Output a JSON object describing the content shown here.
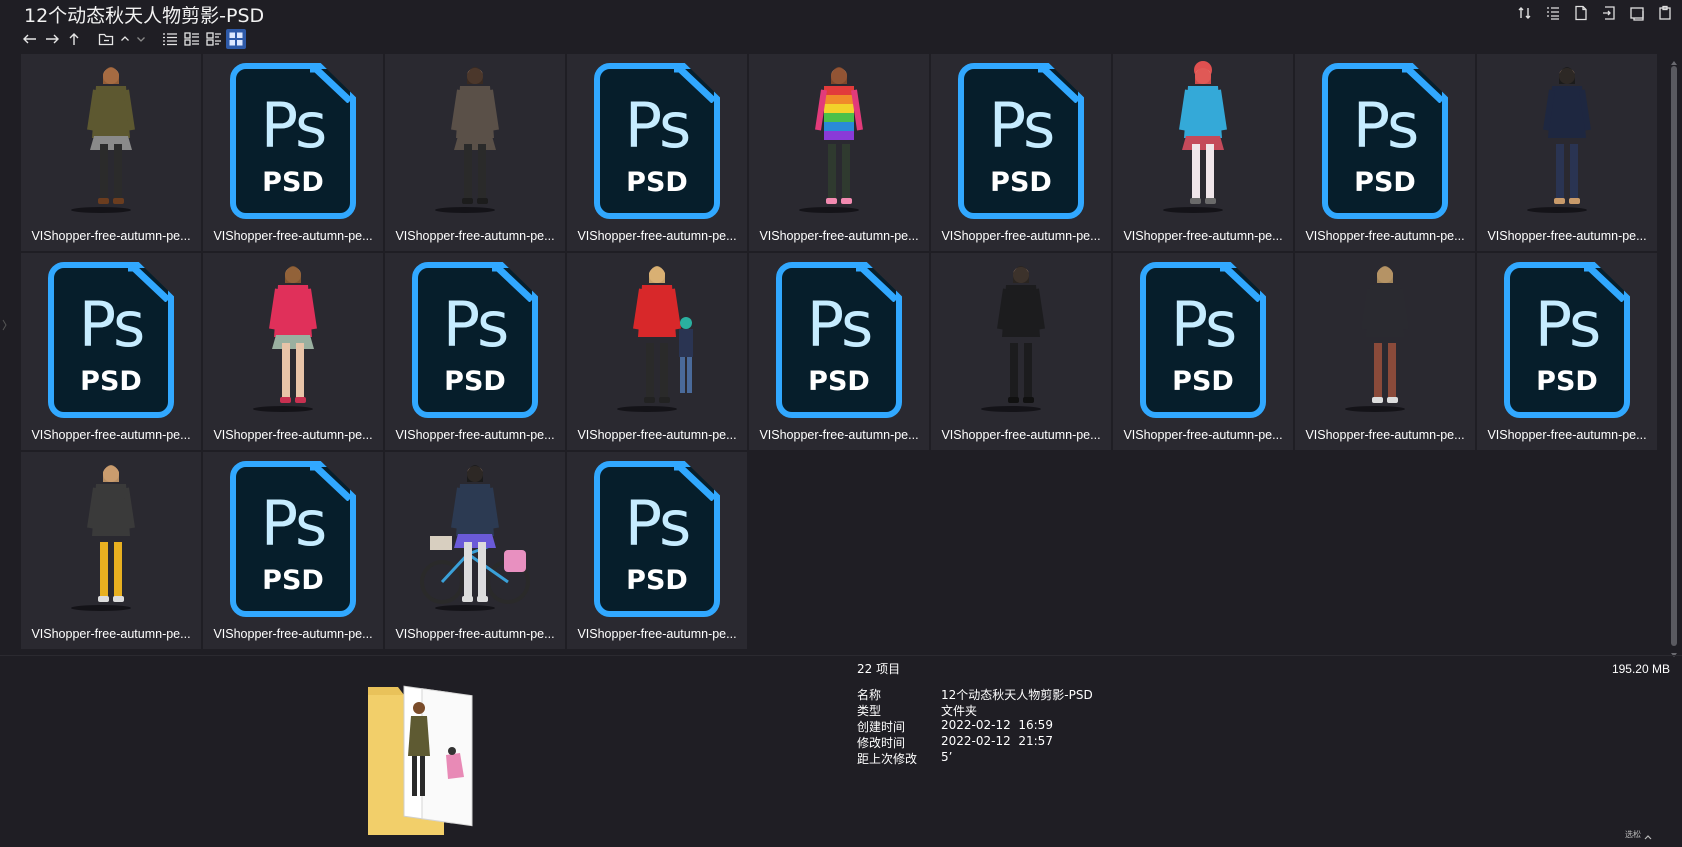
{
  "window": {
    "title": "12个动态秋天人物剪影-PSD",
    "actions": [
      {
        "icon": "sort-icon"
      },
      {
        "icon": "list-detail-icon"
      },
      {
        "icon": "new-file-icon"
      },
      {
        "icon": "file-export-icon"
      },
      {
        "icon": "panel-icon"
      },
      {
        "icon": "clipboard-icon"
      }
    ]
  },
  "toolbar": {
    "nav": [
      "back-arrow-icon",
      "forward-arrow-icon",
      "up-arrow-icon",
      "folder-icon",
      "chevron-up-icon",
      "chevron-down-icon"
    ],
    "views": [
      "list-view-icon",
      "details-view-icon",
      "tiles-view-icon",
      "large-icons-view-icon"
    ],
    "active_view": "large-icons-view-icon"
  },
  "accent_color": "#31a8ff",
  "files": [
    {
      "name": "VIShopper-free-autumn-pe...",
      "kind": "image",
      "figure": "woman-brown-jacket"
    },
    {
      "name": "VIShopper-free-autumn-pe...",
      "kind": "psd"
    },
    {
      "name": "VIShopper-free-autumn-pe...",
      "kind": "image",
      "figure": "woman-grey-coat"
    },
    {
      "name": "VIShopper-free-autumn-pe...",
      "kind": "psd"
    },
    {
      "name": "VIShopper-free-autumn-pe...",
      "kind": "image",
      "figure": "woman-rainbow-jacket"
    },
    {
      "name": "VIShopper-free-autumn-pe...",
      "kind": "psd"
    },
    {
      "name": "VIShopper-free-autumn-pe...",
      "kind": "image",
      "figure": "girl-running-blue"
    },
    {
      "name": "VIShopper-free-autumn-pe...",
      "kind": "psd"
    },
    {
      "name": "VIShopper-free-autumn-pe...",
      "kind": "image",
      "figure": "woman-navy-coat"
    },
    {
      "name": "VIShopper-free-autumn-pe...",
      "kind": "psd"
    },
    {
      "name": "VIShopper-free-autumn-pe...",
      "kind": "image",
      "figure": "woman-pink-jacket"
    },
    {
      "name": "VIShopper-free-autumn-pe...",
      "kind": "psd"
    },
    {
      "name": "VIShopper-free-autumn-pe...",
      "kind": "image",
      "figure": "woman-red-coat-child"
    },
    {
      "name": "VIShopper-free-autumn-pe...",
      "kind": "psd"
    },
    {
      "name": "VIShopper-free-autumn-pe...",
      "kind": "image",
      "figure": "man-dark-suit"
    },
    {
      "name": "VIShopper-free-autumn-pe...",
      "kind": "psd"
    },
    {
      "name": "VIShopper-free-autumn-pe...",
      "kind": "image",
      "figure": "man-grey-coat-phone"
    },
    {
      "name": "VIShopper-free-autumn-pe...",
      "kind": "psd"
    },
    {
      "name": "VIShopper-free-autumn-pe...",
      "kind": "image",
      "figure": "man-yellow-pants"
    },
    {
      "name": "VIShopper-free-autumn-pe...",
      "kind": "psd"
    },
    {
      "name": "VIShopper-free-autumn-pe...",
      "kind": "image",
      "figure": "woman-bicycle"
    },
    {
      "name": "VIShopper-free-autumn-pe...",
      "kind": "psd"
    }
  ],
  "psd_label": {
    "ps": "Ps",
    "ext": "PSD"
  },
  "details": {
    "count": "22 项目",
    "size": "195.20 MB",
    "properties": [
      {
        "label": "名称",
        "value": "12个动态秋天人物剪影-PSD"
      },
      {
        "label": "类型",
        "value": "文件夹"
      },
      {
        "label": "创建时间",
        "value": "2022-02-12  16:59"
      },
      {
        "label": "修改时间",
        "value": "2022-02-12  21:57"
      },
      {
        "label": "距上次修改",
        "value": "5’"
      }
    ],
    "corner_label": "选松"
  }
}
